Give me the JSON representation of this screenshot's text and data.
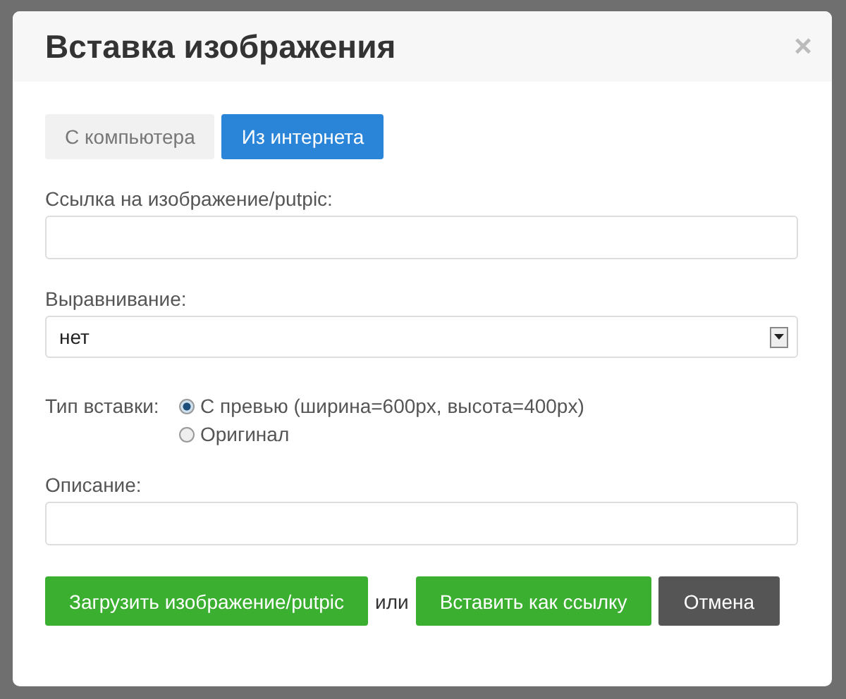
{
  "dialog": {
    "title": "Вставка изображения",
    "close": "×"
  },
  "tabs": [
    {
      "label": "С компьютера",
      "selected": false
    },
    {
      "label": "Из интернета",
      "selected": true
    }
  ],
  "link_field": {
    "label": "Ссылка на изображение/putpic:"
  },
  "align_field": {
    "label": "Выравнивание:",
    "value": "нет"
  },
  "insert_type": {
    "label": "Тип вставки:",
    "options": [
      {
        "label": "С превью (ширина=600px, высота=400px)",
        "selected": true
      },
      {
        "label": "Оригинал",
        "selected": false
      }
    ]
  },
  "description_field": {
    "label": "Описание:"
  },
  "buttons": [
    {
      "label": "Загрузить изображение/putpic",
      "kind": "primary"
    },
    {
      "label": "или",
      "kind": "separator"
    },
    {
      "label": "Вставить как ссылку",
      "kind": "primary"
    },
    {
      "label": "Отмена",
      "kind": "cancel"
    }
  ]
}
